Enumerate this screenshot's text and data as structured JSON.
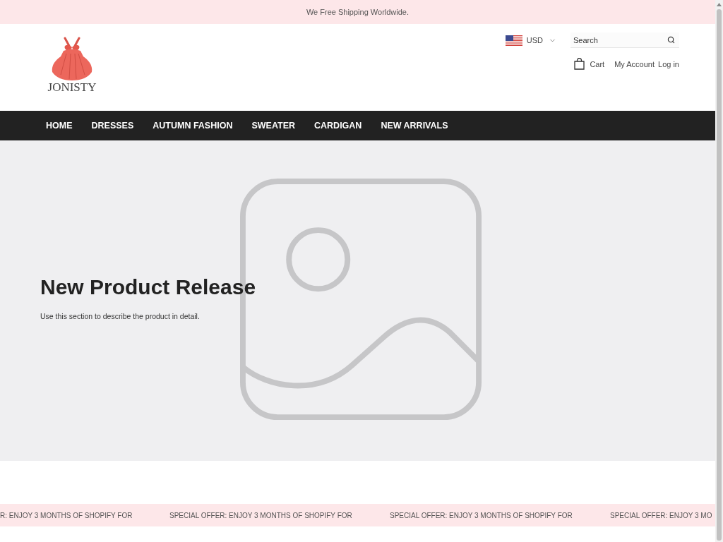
{
  "announcement": {
    "text": "We Free Shipping Worldwide."
  },
  "header": {
    "logo": {
      "text": "JONISTY"
    },
    "currency": {
      "code": "USD"
    },
    "search": {
      "placeholder": "Search"
    },
    "links": [
      {
        "kind": "cart",
        "label": "Cart"
      },
      {
        "kind": "link",
        "label": "My Account"
      },
      {
        "kind": "link",
        "label": "Log in"
      }
    ]
  },
  "nav": {
    "items": [
      "HOME",
      "DRESSES",
      "AUTUMN FASHION",
      "SWEATER",
      "CARDIGAN",
      "NEW ARRIVALS"
    ]
  },
  "hero": {
    "title": "New Product Release",
    "description": "Use this section to describe the product in detail."
  },
  "marquee": {
    "items": [
      "R: ENJOY 3 MONTHS OF SHOPIFY FOR",
      "SPECIAL OFFER: ENJOY 3 MONTHS OF SHOPIFY FOR",
      "SPECIAL OFFER: ENJOY 3 MONTHS OF SHOPIFY FOR",
      "SPECIAL OFFER: ENJOY 3 MO"
    ]
  }
}
